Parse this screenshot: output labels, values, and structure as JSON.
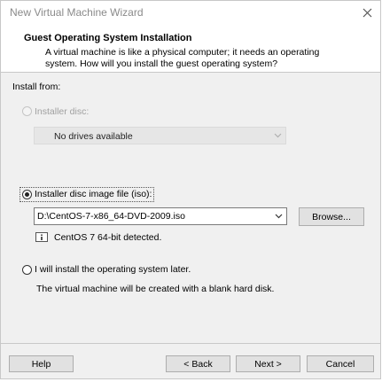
{
  "window": {
    "title": "New Virtual Machine Wizard"
  },
  "header": {
    "title": "Guest Operating System Installation",
    "description": "A virtual machine is like a physical computer; it needs an operating system. How will you install the guest operating system?"
  },
  "install_from": {
    "label": "Install from:",
    "installer_disc": {
      "label": "Installer disc:",
      "selected": false,
      "enabled": false,
      "drive_value": "No drives available"
    },
    "iso": {
      "label": "Installer disc image file (iso):",
      "selected": true,
      "path_value": "D:\\CentOS-7-x86_64-DVD-2009.iso",
      "browse_label": "Browse...",
      "detected_text": "CentOS 7 64-bit detected."
    },
    "later": {
      "label": "I will install the operating system later.",
      "selected": false,
      "note": "The virtual machine will be created with a blank hard disk."
    }
  },
  "footer": {
    "help_label": "Help",
    "back_label": "< Back",
    "next_label": "Next >",
    "cancel_label": "Cancel"
  },
  "colors": {
    "panel": "#f0f0f0",
    "border": "#adadad",
    "disabled_text": "#a0a0a0"
  },
  "icons": {
    "close": "close-icon",
    "detected": "info-icon",
    "dropdown": "chevron-down-icon"
  }
}
